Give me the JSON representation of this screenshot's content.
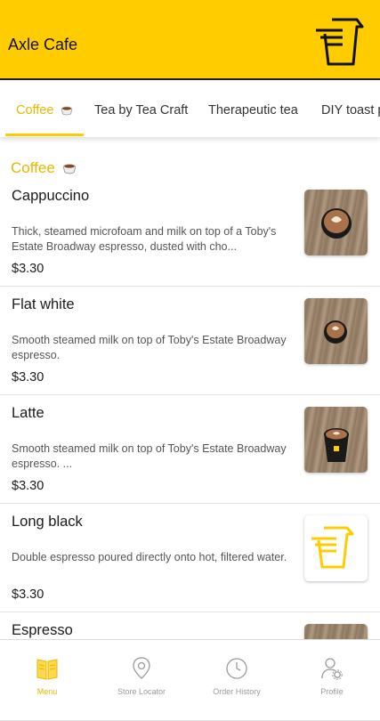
{
  "header": {
    "title": "Axle Cafe"
  },
  "tabs": [
    {
      "label": "Coffee"
    },
    {
      "label": "Tea by Tea Craft"
    },
    {
      "label": "Therapeutic tea"
    },
    {
      "label": "DIY toast p"
    }
  ],
  "section": {
    "title": "Coffee"
  },
  "items": [
    {
      "name": "Cappuccino",
      "description": "Thick, steamed microfoam and milk on top of a Toby's Estate Broadway espresso, dusted with cho...",
      "price": "$3.30"
    },
    {
      "name": "Flat white",
      "description": "Smooth steamed milk on top of Toby's Estate Broadway espresso.",
      "price": "$3.30"
    },
    {
      "name": "Latte",
      "description": "Smooth steamed milk on top of Toby's Estate Broadway espresso.  ...",
      "price": "$3.30"
    },
    {
      "name": "Long black",
      "description": "Double espresso poured directly onto hot, filtered water.",
      "price": "$3.30"
    },
    {
      "name": "Espresso"
    }
  ],
  "nav": [
    {
      "label": "Menu"
    },
    {
      "label": "Store Locator"
    },
    {
      "label": "Order History"
    },
    {
      "label": "Profile"
    }
  ],
  "colors": {
    "brand": "#FFCC00",
    "accent": "#E6B800",
    "muted": "#9a9a9a"
  },
  "icons": {
    "logo": "axle-cup-logo",
    "tab_emoji": "coffee-cup-icon",
    "nav": [
      "menu-book-icon",
      "location-pin-icon",
      "clock-icon",
      "profile-gear-icon"
    ]
  }
}
